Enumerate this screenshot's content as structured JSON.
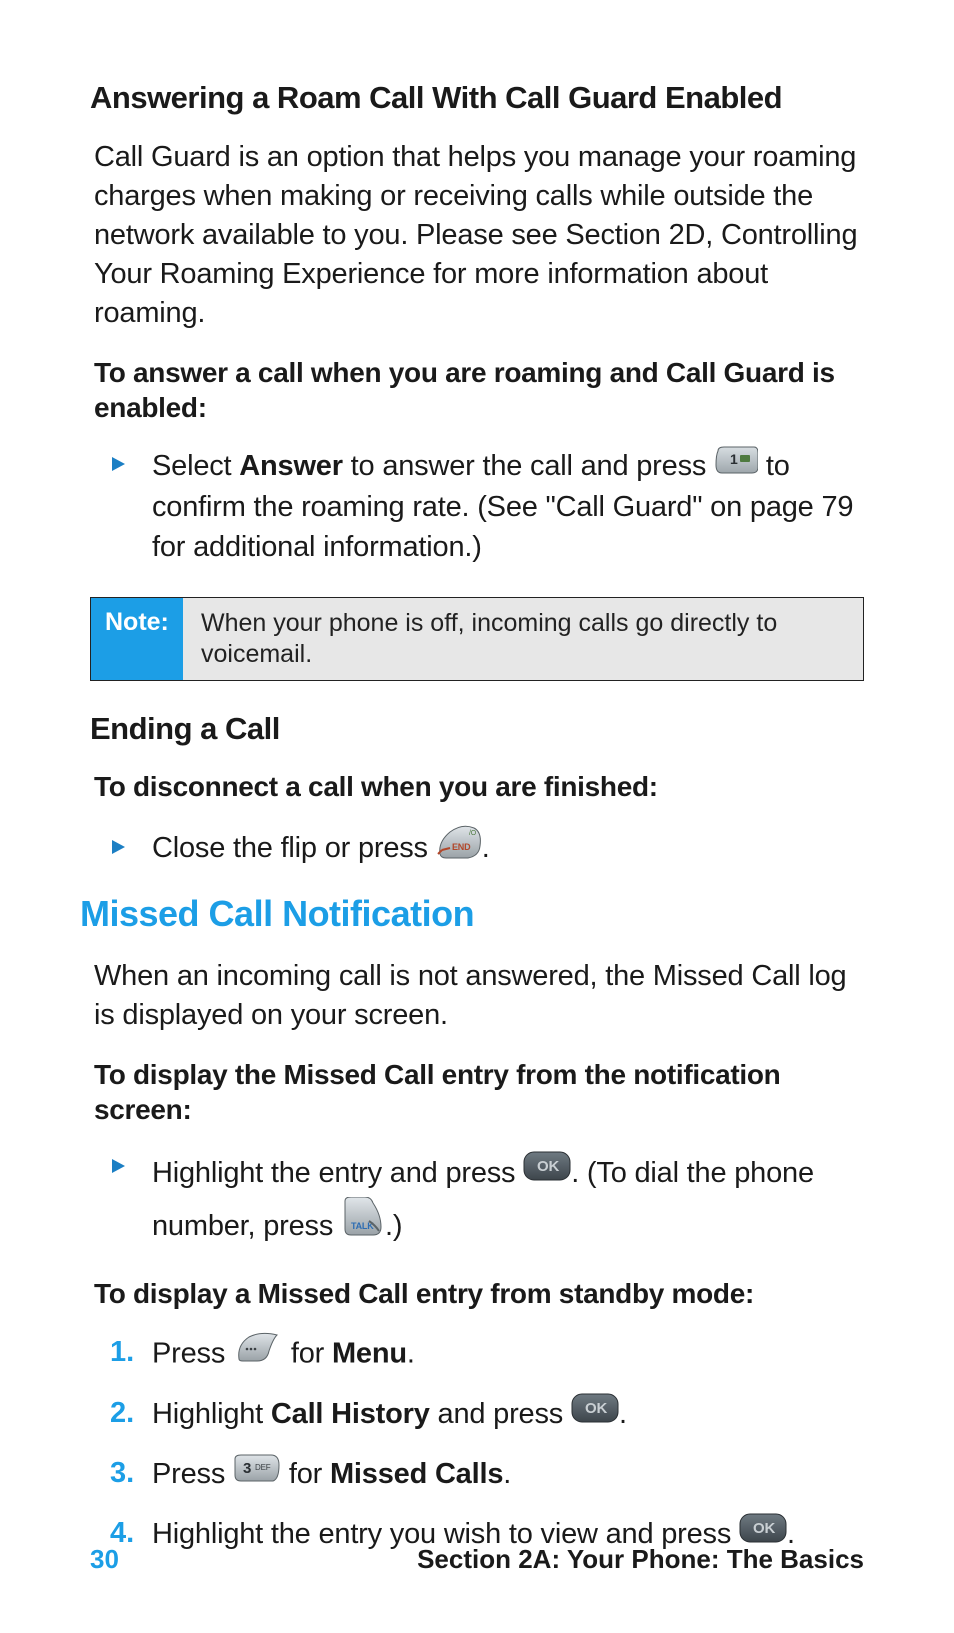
{
  "heading_roam": "Answering a Roam Call With Call Guard Enabled",
  "para_roam": "Call Guard is an option that helps you manage your roaming charges when making or receiving calls while outside the network available to you. Please see Section 2D, Controlling Your Roaming Experience for more information about roaming.",
  "instr_roam": "To answer a call when you are roaming and Call Guard is enabled:",
  "bullet_roam": {
    "pre": "Select ",
    "bold": "Answer",
    "mid": " to answer the call and press ",
    "post": " to confirm the roaming rate. (See \"Call Guard\" on page 79 for additional information.)"
  },
  "note": {
    "label": "Note:",
    "text": "When your phone is off, incoming calls go directly to voicemail."
  },
  "heading_end": "Ending a Call",
  "instr_end": "To disconnect a call when you are finished:",
  "bullet_end": {
    "pre": "Close the flip or press ",
    "post": "."
  },
  "heading_missed": "Missed Call Notification",
  "para_missed": "When an incoming call is not answered, the Missed Call log is displayed on your screen.",
  "instr_missed_notif": "To display the Missed Call entry from the notification screen:",
  "bullet_missed": {
    "pre": "Highlight the entry and press ",
    "mid": ". (To dial the phone number, press ",
    "post": ".)"
  },
  "instr_missed_standby": "To display a Missed Call entry from standby mode:",
  "step1": {
    "pre": "Press ",
    "mid": "  for ",
    "bold": "Menu",
    "post": "."
  },
  "step2": {
    "pre": "Highlight ",
    "bold": "Call History",
    "mid": " and press ",
    "post": "."
  },
  "step3": {
    "pre": "Press ",
    "mid": " for ",
    "bold": "Missed Calls",
    "post": "."
  },
  "step4": {
    "pre": "Highlight the entry you wish to view and press ",
    "post": "."
  },
  "nums": {
    "n1": "1.",
    "n2": "2.",
    "n3": "3.",
    "n4": "4."
  },
  "footer": {
    "page": "30",
    "section": "Section 2A: Your Phone: The Basics"
  }
}
